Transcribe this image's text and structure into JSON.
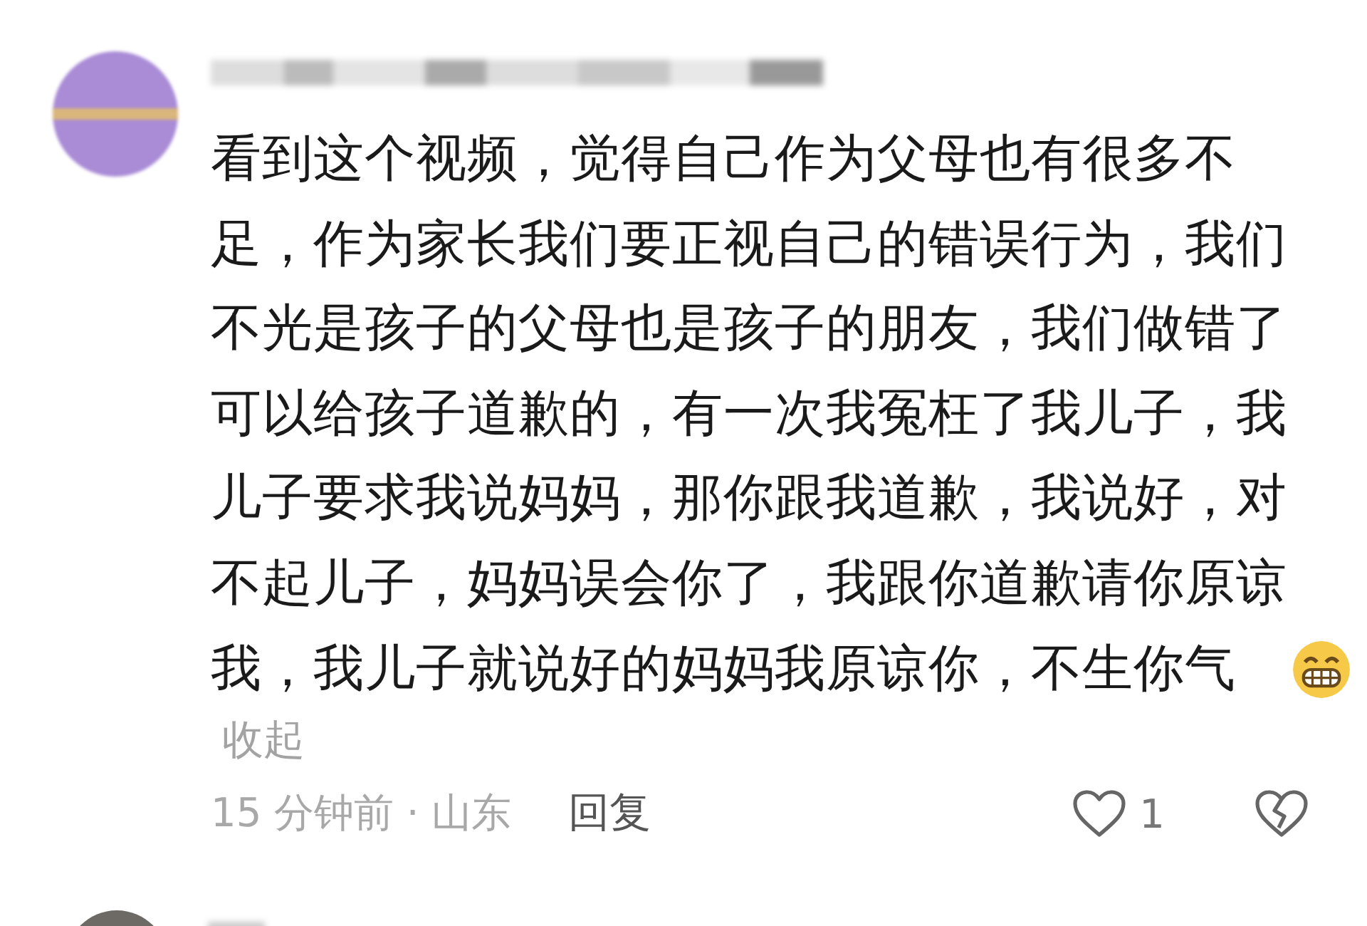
{
  "comment": {
    "text": "看到这个视频，觉得自己作为父母也有很多不足，作为家长我们要正视自己的错误行为，我们不光是孩子的父母也是孩子的朋友，我们做错了可以给孩子道歉的，有一次我冤枉了我儿子，我儿子要求我说妈妈，那你跟我道歉，我说好，对不起儿子，妈妈误会你了，我跟你道歉请你原谅我，我儿子就说好的妈妈我原谅你，不生你气",
    "collapse_link": "收起",
    "time_location": "15 分钟前 · 山东",
    "reply_button": "回复",
    "liked": false,
    "like_count": "1"
  }
}
